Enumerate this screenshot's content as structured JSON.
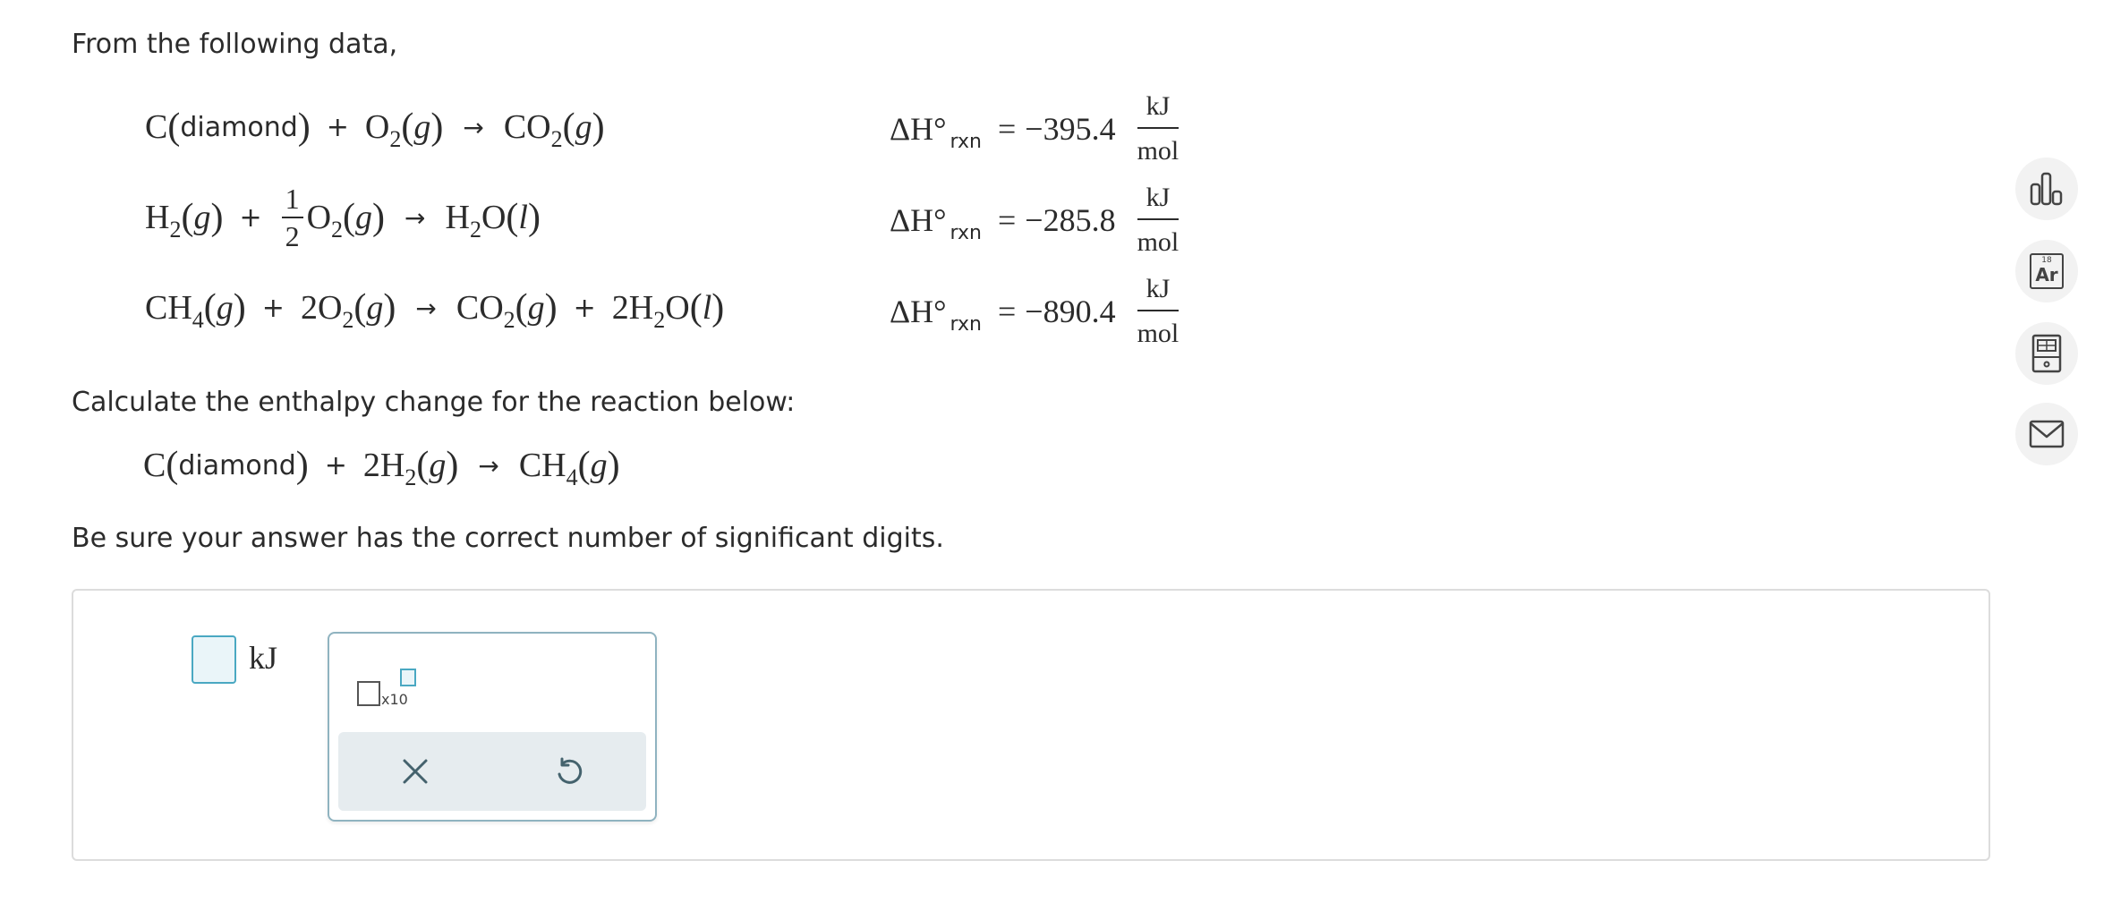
{
  "prompt": {
    "intro": "From the following data,",
    "calculate": "Calculate the enthalpy change for the reaction below:",
    "sigfigs": "Be sure your answer has the correct number of significant digits."
  },
  "reactions": [
    {
      "delta_h_value": "−395.4"
    },
    {
      "delta_h_value": "−285.8"
    },
    {
      "delta_h_value": "−890.4"
    }
  ],
  "delta_h": {
    "symbol": "ΔH°",
    "subscript": "rxn",
    "equals": "=",
    "unit_num": "kJ",
    "unit_den": "mol"
  },
  "equation_labels": {
    "diamond": "diamond",
    "half_num": "1",
    "half_den": "2"
  },
  "answer": {
    "value": "",
    "unit": "kJ"
  },
  "palette": {
    "x10_label": "x10"
  },
  "toolbar": [
    {
      "name": "chart-icon"
    },
    {
      "name": "periodic-table-icon",
      "badge_number": "18",
      "badge_symbol": "Ar"
    },
    {
      "name": "calculator-icon"
    },
    {
      "name": "mail-icon"
    }
  ],
  "colors": {
    "accent": "#4aa8c2",
    "palette_border": "#8fb3c0",
    "palette_tray": "#e6ecef",
    "tool_icon": "#44626d"
  }
}
